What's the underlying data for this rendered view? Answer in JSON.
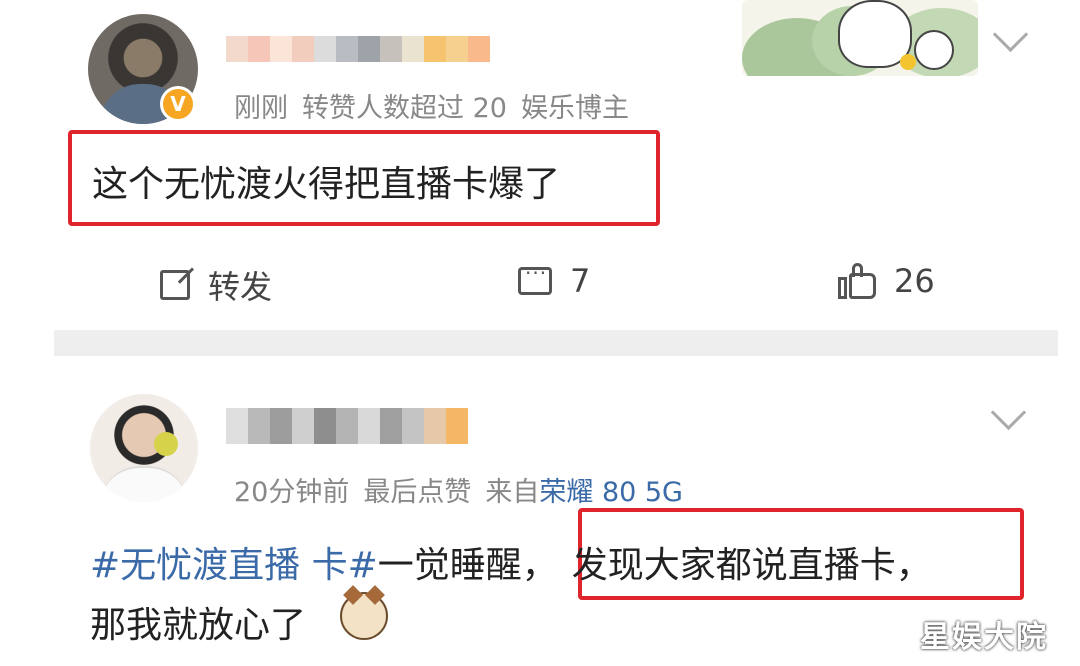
{
  "post1": {
    "badge": "V",
    "meta": {
      "time": "刚刚",
      "tag": "转赞人数超过 20",
      "role": "娱乐博主"
    },
    "text": "这个无忧渡火得把直播卡爆了",
    "actions": {
      "repost_label": "转发",
      "comments_count": "7",
      "likes_count": "26"
    },
    "name_blur_colors": [
      "#f3d9cc",
      "#f6c7b9",
      "#fbe5d8",
      "#f2cdbd",
      "#dcdcdc",
      "#b9bcc2",
      "#9ea3aa",
      "#c6c1bb",
      "#e9e3cf",
      "#f6c36f",
      "#f6d08e",
      "#f9b98a"
    ],
    "icons": [
      "chevron-down-icon",
      "share-icon",
      "comment-icon",
      "like-icon"
    ]
  },
  "post2": {
    "meta": {
      "time": "20分钟前",
      "action": "最后点赞",
      "from_label": "来自",
      "device": "荣耀 80 5G"
    },
    "text": {
      "hashtag": "#无忧渡直播 卡#",
      "part1": "一觉睡醒，",
      "highlight": "发现大家都说直播卡，",
      "line2": "那我就放心了"
    },
    "name_blur_colors": [
      "#dedede",
      "#b9b9b9",
      "#9d9d9d",
      "#cfcfcf",
      "#8e8e8e",
      "#b4b4b4",
      "#d9d9d9",
      "#9f9f9f",
      "#c4c4c4",
      "#e6c9a8",
      "#f3b766"
    ],
    "icons": [
      "chevron-down-icon"
    ]
  },
  "watermark": "星娱大院",
  "colors": {
    "highlight": "#e0242b",
    "link": "#3b6aa8",
    "meta": "#888888"
  }
}
